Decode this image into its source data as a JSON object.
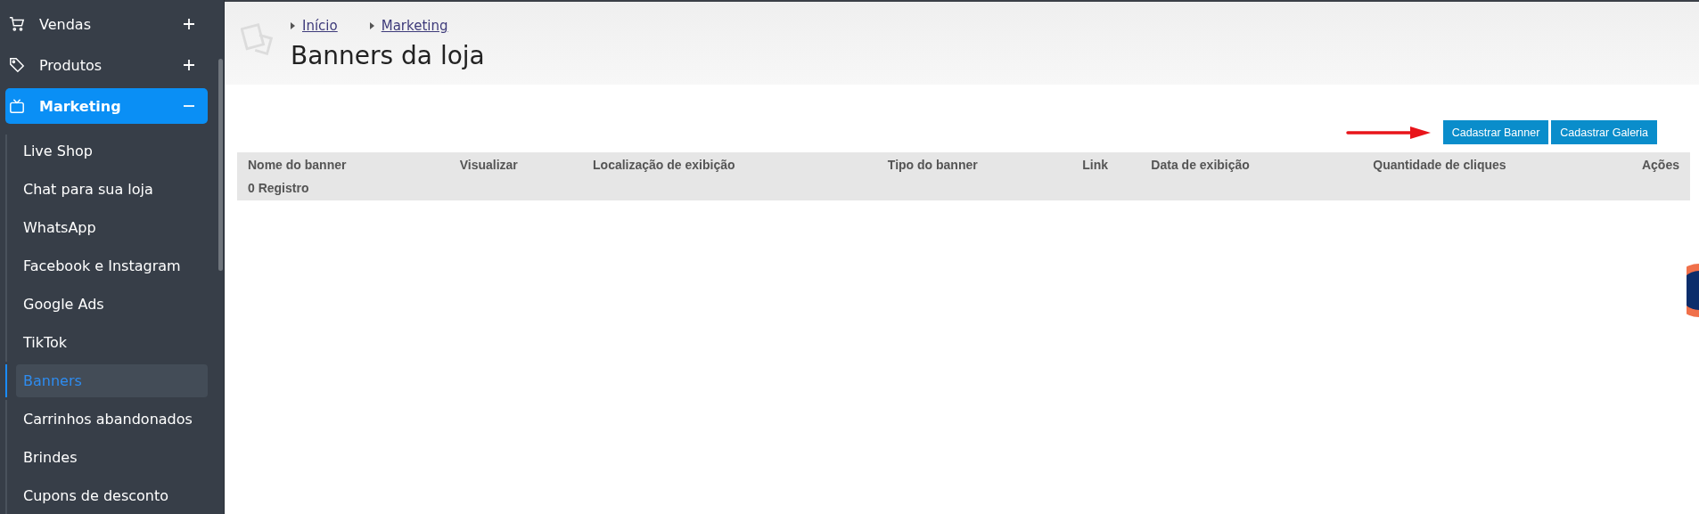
{
  "sidebar": {
    "groups": [
      {
        "label": "Vendas",
        "expanded": false,
        "selected": false
      },
      {
        "label": "Produtos",
        "expanded": false,
        "selected": false
      },
      {
        "label": "Marketing",
        "expanded": true,
        "selected": true,
        "children": [
          {
            "label": "Live Shop",
            "selected": false
          },
          {
            "label": "Chat para sua loja",
            "selected": false
          },
          {
            "label": "WhatsApp",
            "selected": false
          },
          {
            "label": "Facebook e Instagram",
            "selected": false
          },
          {
            "label": "Google Ads",
            "selected": false
          },
          {
            "label": "TikTok",
            "selected": false
          },
          {
            "label": "Banners",
            "selected": true
          },
          {
            "label": "Carrinhos abandonados",
            "selected": false
          },
          {
            "label": "Brindes",
            "selected": false
          },
          {
            "label": "Cupons de desconto",
            "selected": false
          }
        ]
      }
    ]
  },
  "breadcrumb": [
    "Início",
    "Marketing"
  ],
  "page_title": "Banners da loja",
  "buttons": [
    "Cadastrar Banner",
    "Cadastrar Galeria"
  ],
  "table": {
    "columns": [
      "Nome do banner",
      "Visualizar",
      "Localização de exibição",
      "Tipo do banner",
      "Link",
      "Data de exibição",
      "Quantidade de cliques",
      "Ações"
    ],
    "footer": "0 Registro"
  }
}
